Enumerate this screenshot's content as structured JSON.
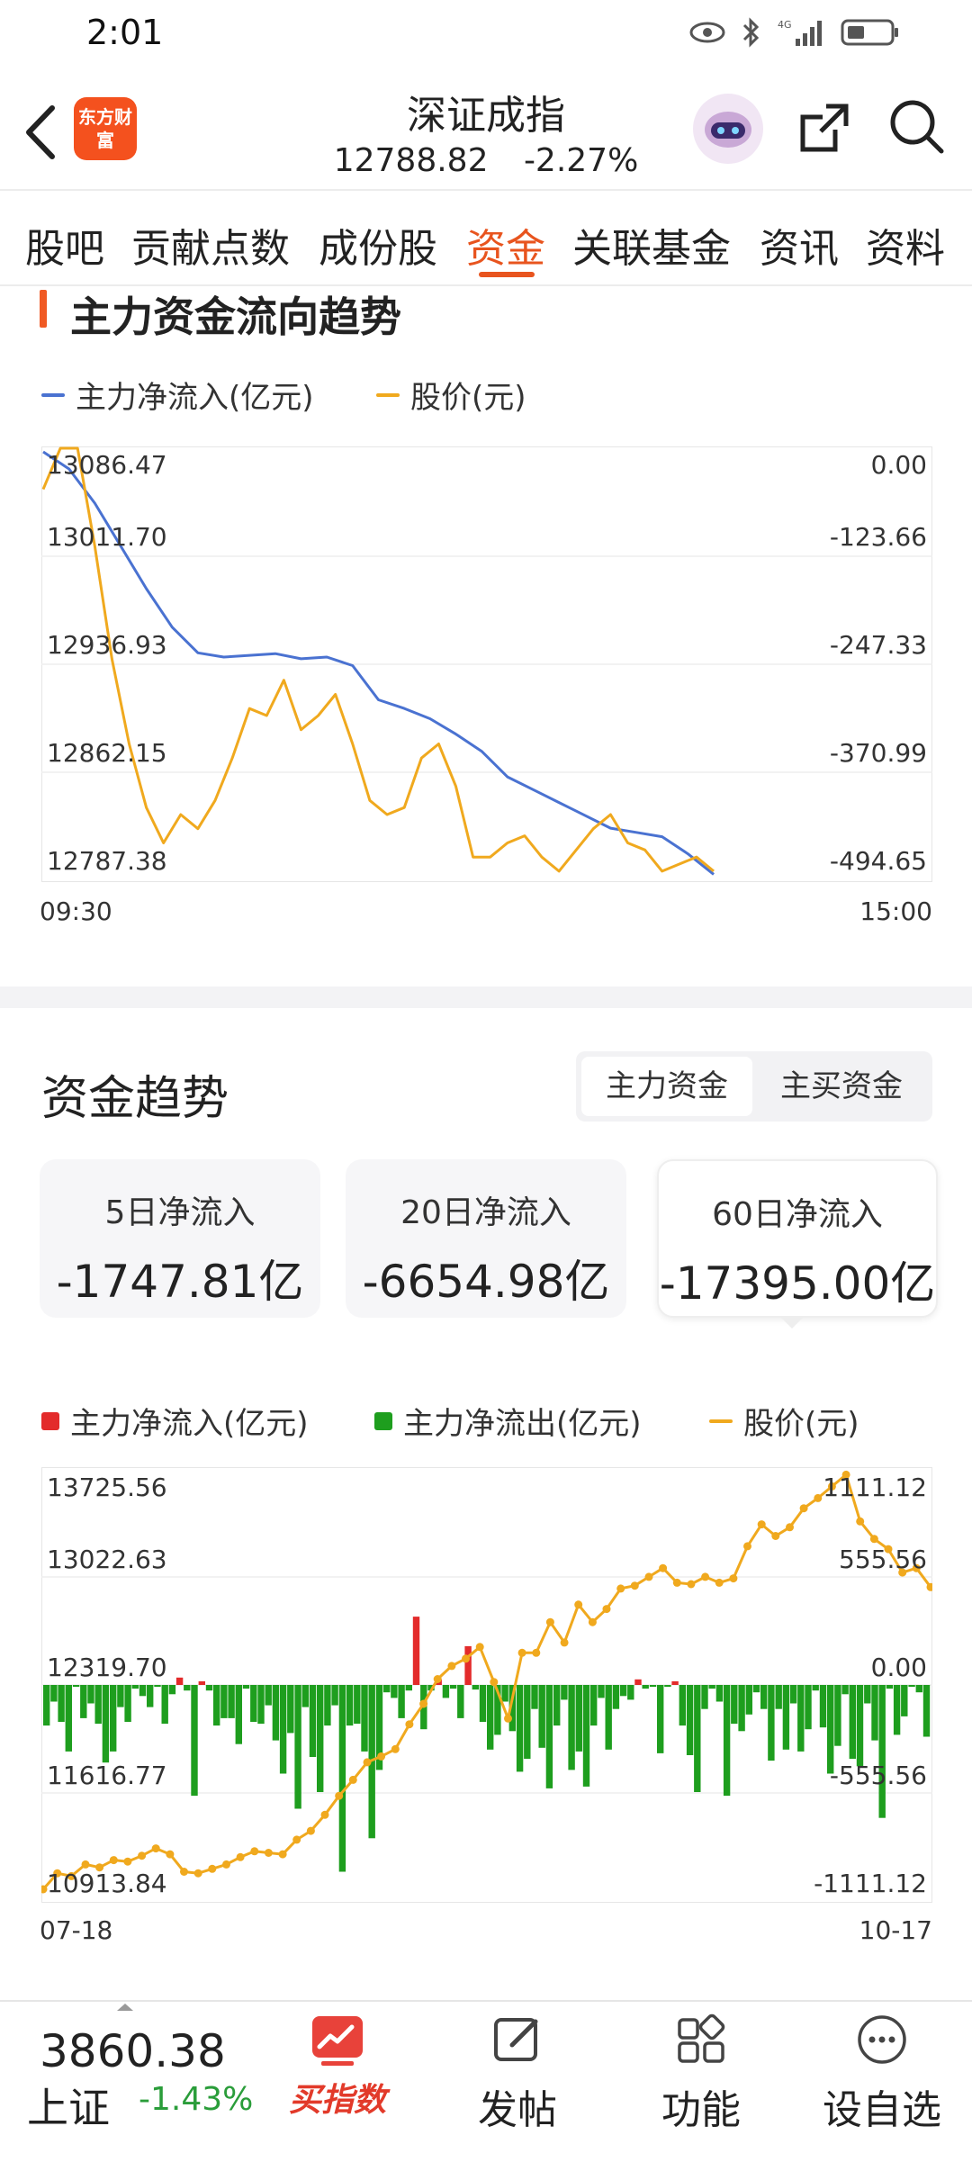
{
  "status_bar": {
    "time": "2:01",
    "icons": [
      "eye-icon",
      "bluetooth-icon",
      "signal-4g-icon",
      "battery-icon"
    ]
  },
  "header": {
    "logo_text": "东方财富",
    "title": "深证成指",
    "price": "12788.82",
    "change": "-2.27%"
  },
  "tabs": [
    "股吧",
    "贡献点数",
    "成份股",
    "资金",
    "关联基金",
    "资讯",
    "资料"
  ],
  "active_tab": "资金",
  "flow_section": {
    "title": "主力资金流向趋势",
    "legend": [
      {
        "label": "主力净流入(亿元)",
        "color": "#4a72d1"
      },
      {
        "label": "股价(元)",
        "color": "#f0a91e"
      }
    ],
    "left_ticks": [
      "13086.47",
      "13011.70",
      "12936.93",
      "12862.15",
      "12787.38"
    ],
    "right_ticks": [
      "0.00",
      "-123.66",
      "-247.33",
      "-370.99",
      "-494.65"
    ],
    "x_start": "09:30",
    "x_end": "15:00"
  },
  "trend_section": {
    "title": "资金趋势",
    "toggle": [
      "主力资金",
      "主买资金"
    ],
    "toggle_active": "主力资金",
    "cards": [
      {
        "label": "5日净流入",
        "value": "-1747.81亿"
      },
      {
        "label": "20日净流入",
        "value": "-6654.98亿"
      },
      {
        "label": "60日净流入",
        "value": "-17395.00亿"
      }
    ],
    "selected_card": "60日净流入",
    "legend": [
      {
        "label": "主力净流入(亿元)",
        "color": "#e32b2b"
      },
      {
        "label": "主力净流出(亿元)",
        "color": "#1e9e1e"
      },
      {
        "label": "股价(元)",
        "color": "#f0a91e"
      }
    ],
    "left_ticks": [
      "13725.56",
      "13022.63",
      "12319.70",
      "11616.77",
      "10913.84"
    ],
    "right_ticks": [
      "1111.12",
      "555.56",
      "0.00",
      "-555.56",
      "-1111.12"
    ],
    "x_start": "07-18",
    "x_end": "10-17"
  },
  "bottom_bar": {
    "index_value": "3860.38",
    "index_name": "上证",
    "index_change": "-1.43%",
    "items": [
      {
        "label": "买指数",
        "icon": "trend-chart-icon"
      },
      {
        "label": "发帖",
        "icon": "edit-icon"
      },
      {
        "label": "功能",
        "icon": "grid-icon"
      },
      {
        "label": "设自选",
        "icon": "more-icon"
      }
    ]
  },
  "chart_data": [
    {
      "type": "line",
      "title": "主力资金流向趋势",
      "x_range": [
        "09:30",
        "15:00"
      ],
      "series": [
        {
          "name": "主力净流入(亿元)",
          "axis": "right",
          "ylim": [
            -494.65,
            0.0
          ],
          "values": [
            0,
            -20,
            -60,
            -110,
            -160,
            -205,
            -235,
            -240,
            -238,
            -236,
            -242,
            -240,
            -250,
            -290,
            -300,
            -312,
            -330,
            -350,
            -380,
            -395,
            -410,
            -425,
            -440,
            -445,
            -450,
            -470,
            -494
          ]
        },
        {
          "name": "股价(元)",
          "axis": "left",
          "ylim": [
            12787.38,
            13086.47
          ],
          "values": [
            13060,
            13095,
            13100,
            13020,
            12940,
            12880,
            12835,
            12810,
            12830,
            12820,
            12840,
            12870,
            12905,
            12900,
            12925,
            12890,
            12900,
            12915,
            12880,
            12840,
            12830,
            12835,
            12870,
            12880,
            12850,
            12800,
            12800,
            12810,
            12815,
            12800,
            12790,
            12805,
            12820,
            12830,
            12810,
            12805,
            12790,
            12795,
            12800,
            12790
          ]
        }
      ]
    },
    {
      "type": "bar",
      "title": "资金趋势",
      "x_range": [
        "07-18",
        "10-17"
      ],
      "series": [
        {
          "name": "主力净流入/流出(亿元)",
          "axis": "right",
          "ylim": [
            -1111.12,
            1111.12
          ],
          "values": [
            -220,
            -90,
            -200,
            -360,
            -10,
            -180,
            -100,
            -210,
            -420,
            -360,
            -120,
            -200,
            -20,
            -60,
            -120,
            -10,
            -210,
            -50,
            40,
            -30,
            -600,
            20,
            -30,
            -220,
            -180,
            -180,
            -320,
            -20,
            -200,
            -210,
            -110,
            -300,
            -480,
            -260,
            -670,
            -120,
            -390,
            -580,
            -220,
            -110,
            -1011,
            -220,
            -210,
            -360,
            -830,
            -460,
            -40,
            -70,
            -180,
            -30,
            370,
            -240,
            -30,
            30,
            -70,
            -20,
            -180,
            210,
            -25,
            -200,
            -350,
            -270,
            -90,
            -250,
            -470,
            -400,
            -130,
            -340,
            -560,
            -220,
            -80,
            -460,
            -360,
            -550,
            -220,
            -70,
            -350,
            -130,
            -60,
            -80,
            30,
            -20,
            -10,
            -370,
            -10,
            20,
            -220,
            -380,
            -580,
            -130,
            -20,
            -90,
            -600,
            -210,
            -250,
            -160,
            -40,
            -130,
            -410,
            -130,
            -350,
            -100,
            -360,
            -240,
            -30,
            -230,
            -480,
            -330,
            -50,
            -400,
            -440,
            -100,
            -300,
            -720,
            -20,
            -270,
            -170,
            -10,
            -40,
            -280
          ]
        },
        {
          "name": "股价(元)",
          "axis": "left",
          "ylim": [
            10913.84,
            13725.56
          ],
          "values": [
            10920,
            11030,
            11010,
            11090,
            11070,
            11120,
            11110,
            11150,
            11200,
            11160,
            11040,
            11030,
            11060,
            11090,
            11140,
            11180,
            11170,
            11160,
            11260,
            11320,
            11430,
            11560,
            11670,
            11790,
            11830,
            11880,
            12050,
            12190,
            12360,
            12450,
            12500,
            12580,
            12340,
            12090,
            12540,
            12540,
            12750,
            12610,
            12870,
            12750,
            12840,
            12980,
            13000,
            13060,
            13120,
            13020,
            13010,
            13060,
            13020,
            13050,
            13270,
            13420,
            13340,
            13400,
            13530,
            13600,
            13680,
            13760,
            13440,
            13320,
            13250,
            13090,
            13120,
            12990
          ]
        }
      ]
    }
  ]
}
